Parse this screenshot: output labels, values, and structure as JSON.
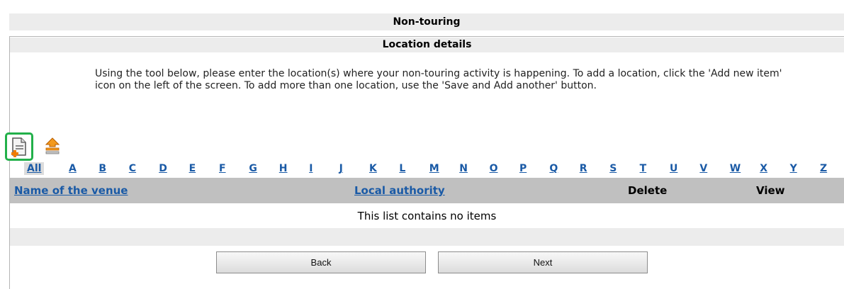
{
  "header": {
    "title": "Non-touring",
    "subtitle": "Location details"
  },
  "instructions": "Using the tool below, please enter the location(s) where your non-touring activity is happening. To add a location, click the 'Add new item' icon on the left of the screen. To add more than one location, use the 'Save and Add another' button.",
  "toolbar": {
    "add_icon": "add-new-item-icon",
    "upload_icon": "upload-icon",
    "accent_color": "#22b04a"
  },
  "alphabet": {
    "all_label": "All",
    "letters": [
      "A",
      "B",
      "C",
      "D",
      "E",
      "F",
      "G",
      "H",
      "I",
      "J",
      "K",
      "L",
      "M",
      "N",
      "O",
      "P",
      "Q",
      "R",
      "S",
      "T",
      "U",
      "V",
      "W",
      "X",
      "Y",
      "Z"
    ]
  },
  "table": {
    "columns": {
      "venue": "Name of the venue",
      "authority": "Local authority",
      "delete": "Delete",
      "view": "View"
    },
    "empty_message": "This list contains no items"
  },
  "buttons": {
    "back": "Back",
    "next": "Next"
  }
}
